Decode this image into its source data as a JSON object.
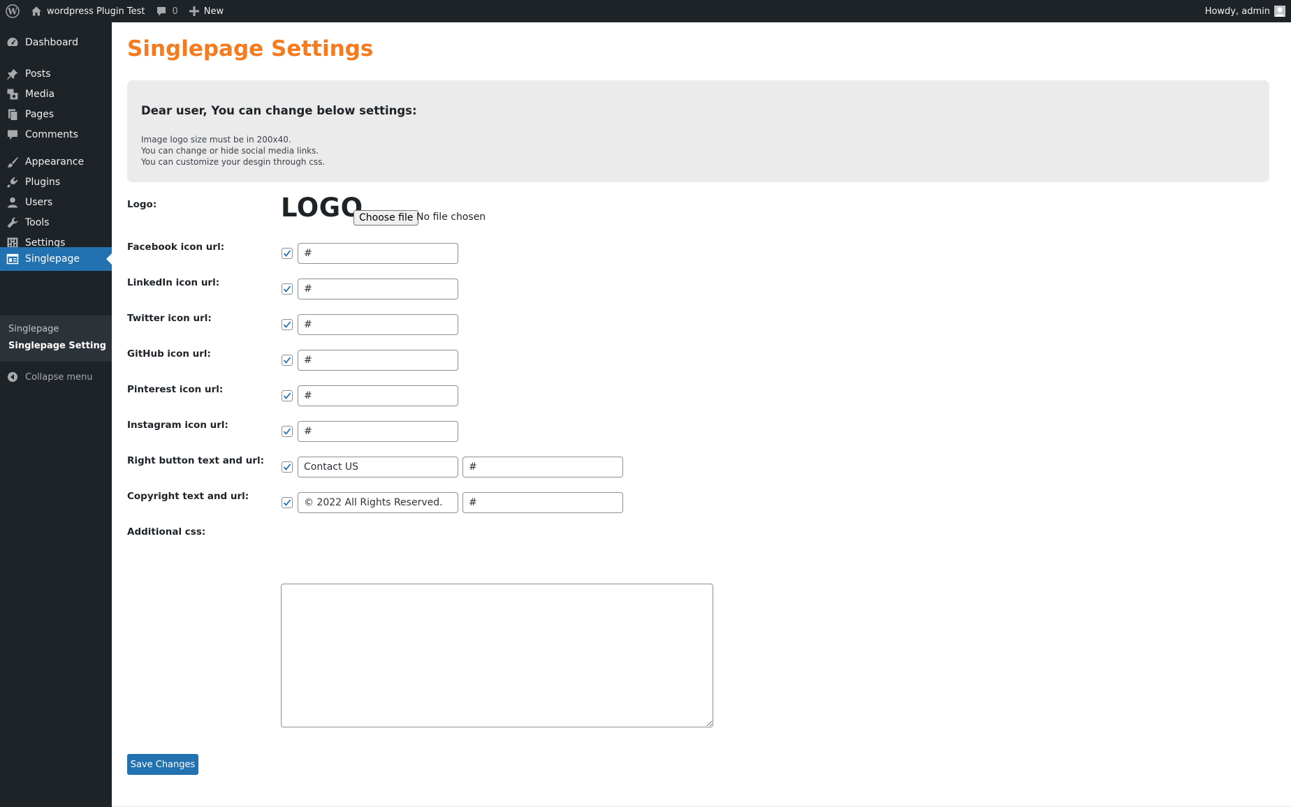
{
  "adminbar": {
    "site_name": "wordpress Plugin Test",
    "comments_count": "0",
    "new_label": "New",
    "greeting": "Howdy, admin"
  },
  "sidebar": {
    "items": [
      {
        "label": "Dashboard",
        "icon": "dashboard-icon"
      },
      {
        "label": "Posts",
        "icon": "pin-icon"
      },
      {
        "label": "Media",
        "icon": "media-icon"
      },
      {
        "label": "Pages",
        "icon": "pages-icon"
      },
      {
        "label": "Comments",
        "icon": "comment-icon"
      },
      {
        "label": "Appearance",
        "icon": "brush-icon"
      },
      {
        "label": "Plugins",
        "icon": "plugin-icon"
      },
      {
        "label": "Users",
        "icon": "user-icon"
      },
      {
        "label": "Tools",
        "icon": "wrench-icon"
      },
      {
        "label": "Settings",
        "icon": "settings-icon"
      },
      {
        "label": "Singlepage",
        "icon": "singlepage-icon"
      }
    ],
    "submenu": [
      "Singlepage",
      "Singlepage Setting"
    ],
    "collapse_label": "Collapse menu"
  },
  "page": {
    "title": "Singlepage Settings",
    "notice": {
      "heading": "Dear user, You can change below settings:",
      "lines": [
        "Image logo size must be in 200x40.",
        "You can change or hide social media links.",
        "You can customize your desgin through css."
      ]
    },
    "logo": {
      "label": "Logo:",
      "preview_text": "LOGO",
      "file_button": "Choose file",
      "file_status": "No file chosen"
    },
    "fields": [
      {
        "label": "Facebook icon url:",
        "checked": true,
        "value": "#"
      },
      {
        "label": "LinkedIn icon url:",
        "checked": true,
        "value": "#"
      },
      {
        "label": "Twitter icon url:",
        "checked": true,
        "value": "#"
      },
      {
        "label": "GitHub icon url:",
        "checked": true,
        "value": "#"
      },
      {
        "label": "Pinterest icon url:",
        "checked": true,
        "value": "#"
      },
      {
        "label": "Instagram icon url:",
        "checked": true,
        "value": "#"
      },
      {
        "label": "Right button text and url:",
        "checked": true,
        "value": "Contact US",
        "url": "#"
      },
      {
        "label": "Copyright text and url:",
        "checked": true,
        "value": "© 2022 All Rights Reserved.",
        "url": "#"
      }
    ],
    "additional_css": {
      "label": "Additional css:",
      "value": ""
    },
    "save_label": "Save Changes"
  },
  "colors": {
    "admin_bg": "#1d2327",
    "accent_blue": "#2271b1",
    "title_orange": "#f47b20",
    "notice_bg": "#ebebeb"
  }
}
